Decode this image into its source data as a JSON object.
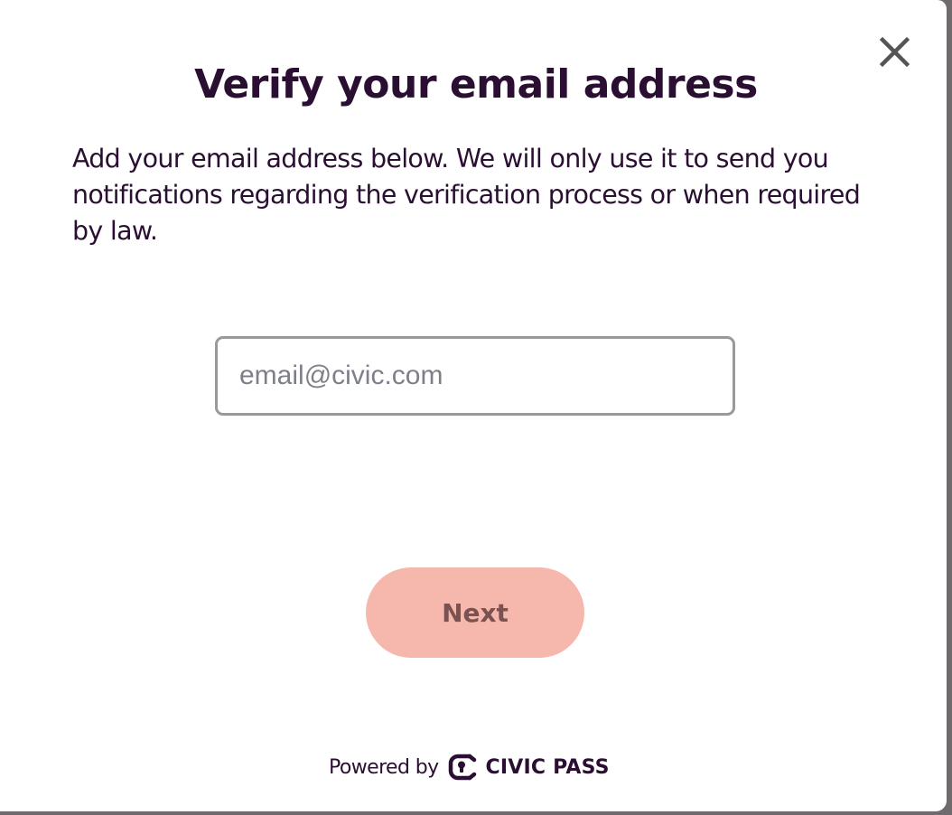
{
  "modal": {
    "title": "Verify your email address",
    "description": "Add your email address below. We will only use it to send you notifications regarding the verification process or when required by law.",
    "email_field": {
      "placeholder": "email@civic.com",
      "value": ""
    },
    "next_label": "Next",
    "close_icon": "close-icon"
  },
  "footer": {
    "powered_by": "Powered by",
    "brand": "CIVIC PASS",
    "brand_icon": "civic-lock-icon"
  },
  "colors": {
    "text": "#2b0f33",
    "button_bg": "#f6b8ac",
    "button_text": "#7a5252",
    "input_border": "#999999",
    "placeholder": "#7d8089"
  }
}
